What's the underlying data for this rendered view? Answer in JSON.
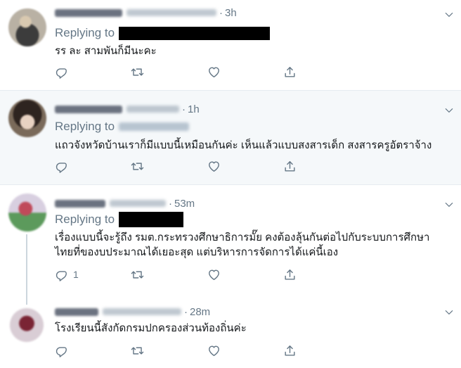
{
  "tweets": [
    {
      "time": "3h",
      "replying_label": "Replying to",
      "text": "รร ละ สามพันก็มีนะคะ",
      "reply_count": ""
    },
    {
      "time": "1h",
      "replying_label": "Replying to",
      "text": "แถวจังหวัดบ้านเราก็มีแบบนี้เหมือนกันค่ะ เห็นแล้วแบบสงสารเด็ก สงสารครูอัตราจ้าง",
      "reply_count": ""
    },
    {
      "time": "53m",
      "replying_label": "Replying to",
      "text_line1": "เรื่องแบบนี้จะรู้ถึง รมต.กระทรวงศึกษาธิการมั๊ย คงต้องลุ้นกันต่อไปกับระบบการศึกษา",
      "text_line2": "ไทยที่ของบประมาณได้เยอะสุด แต่บริหารการจัดการได้แค่นี้เอง",
      "reply_count": "1"
    },
    {
      "time": "28m",
      "text": "โรงเรียนนี้สังกัดกรมปกครองส่วนท้องถิ่นค่ะ",
      "reply_count": ""
    }
  ],
  "icons": [
    "chevron-down-icon",
    "reply-icon",
    "retweet-icon",
    "like-icon",
    "share-icon"
  ],
  "colors": {
    "secondary_text": "#657786",
    "highlight_bg": "#f5f8fa",
    "border": "#e6ecf0",
    "thread_line": "#ccd6dd"
  }
}
